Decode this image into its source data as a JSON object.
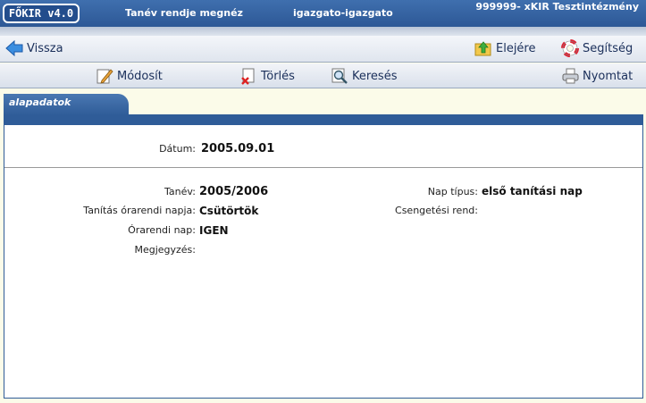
{
  "titlebar": {
    "logo": "FŐKIR v4.0",
    "title": "Tanév rendje megnéz",
    "user": "igazgato-igazgato",
    "institution": "999999- xKIR Tesztintézmény"
  },
  "toolbar1": {
    "back": "Vissza",
    "top": "Elejére",
    "help": "Segítség"
  },
  "toolbar2": {
    "edit": "Módosít",
    "delete": "Törlés",
    "search": "Keresés",
    "print": "Nyomtat"
  },
  "tab": {
    "label": "alapadatok"
  },
  "form": {
    "date_label": "Dátum:",
    "date_value": "2005.09.01",
    "year_label": "Tanév:",
    "year_value": "2005/2006",
    "timetable_day_label": "Tanítás órarendi napja:",
    "timetable_day_value": "Csütörtök",
    "timetable_flag_label": "Órarendi nap:",
    "timetable_flag_value": "IGEN",
    "note_label": "Megjegyzés:",
    "note_value": "",
    "day_type_label": "Nap típus:",
    "day_type_value": "első tanítási nap",
    "bell_label": "Csengetési rend:",
    "bell_value": ""
  },
  "icons": {
    "back": "arrow-left-icon",
    "top": "folder-up-icon",
    "help": "lifebuoy-icon",
    "edit": "pencil-icon",
    "delete": "delete-doc-icon",
    "search": "magnifier-icon",
    "print": "printer-icon"
  },
  "colors": {
    "titlebar": "#2d5896",
    "panel_border": "#2f5c98",
    "background": "#fbfbe9"
  }
}
